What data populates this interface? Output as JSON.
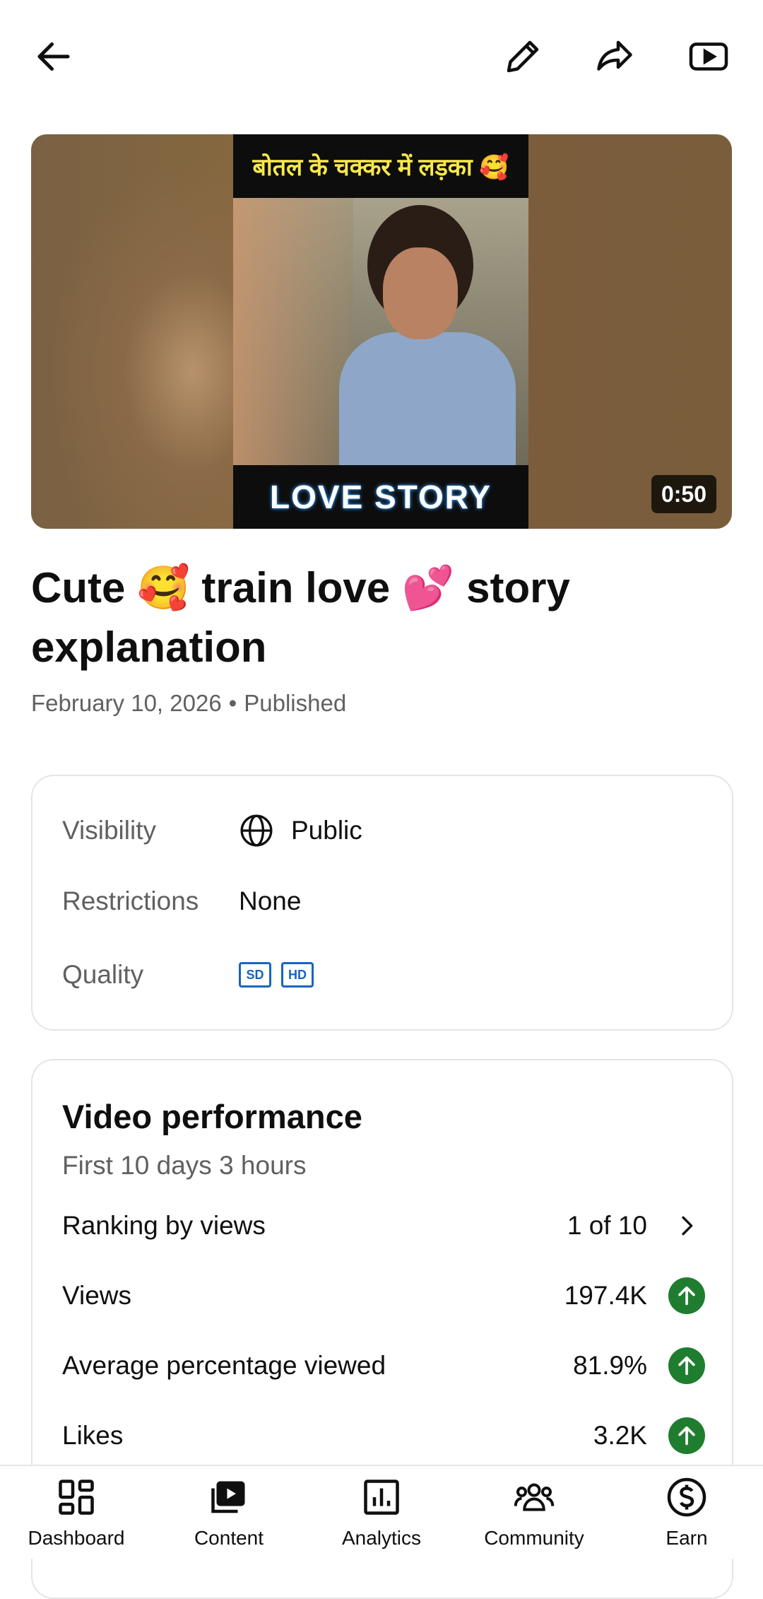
{
  "topbar": {
    "back_icon": "arrow-left-icon",
    "edit_icon": "pencil-icon",
    "share_icon": "share-icon",
    "youtube_icon": "youtube-play-icon"
  },
  "video": {
    "thumbnail_top_caption": "बोतल के चक्कर में लड़का 🥰",
    "thumbnail_bottom_caption": "LOVE STORY",
    "duration": "0:50",
    "title": "Cute 🥰 train love 💕 story explanation",
    "date": "February 10, 2026",
    "separator": "•",
    "status": "Published"
  },
  "info": {
    "visibility_label": "Visibility",
    "visibility_value": "Public",
    "restrictions_label": "Restrictions",
    "restrictions_value": "None",
    "quality_label": "Quality",
    "quality_badges": [
      "SD",
      "HD"
    ]
  },
  "performance": {
    "title": "Video performance",
    "subtitle": "First 10 days 3 hours",
    "rows": [
      {
        "label": "Ranking by views",
        "value": "1 of 10",
        "indicator": "chevron-right-icon"
      },
      {
        "label": "Views",
        "value": "197.4K",
        "indicator": "arrow-up-icon"
      },
      {
        "label": "Average percentage viewed",
        "value": "81.9%",
        "indicator": "arrow-up-icon"
      },
      {
        "label": "Likes",
        "value": "3.2K",
        "indicator": "arrow-up-icon"
      }
    ],
    "trend_color": "#1e7d2e"
  },
  "nav": {
    "items": [
      {
        "label": "Dashboard",
        "icon": "dashboard-icon"
      },
      {
        "label": "Content",
        "icon": "content-icon"
      },
      {
        "label": "Analytics",
        "icon": "analytics-icon"
      },
      {
        "label": "Community",
        "icon": "community-icon"
      },
      {
        "label": "Earn",
        "icon": "earn-icon"
      }
    ]
  },
  "colors": {
    "accent_blue": "#1565c0",
    "secondary_text": "#606060",
    "border": "#e5e5e5"
  }
}
